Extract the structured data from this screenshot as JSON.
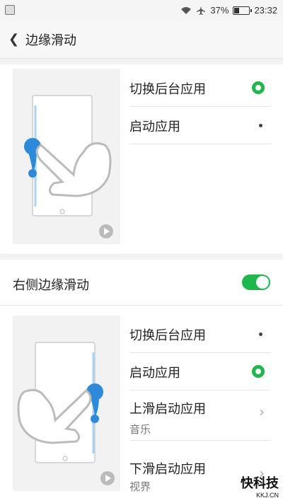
{
  "status": {
    "battery": "37%",
    "time": "23:32"
  },
  "header": {
    "title": "边缘滑动"
  },
  "left_edge": {
    "items": [
      {
        "label": "切换后台应用",
        "selected": true
      },
      {
        "label": "启动应用",
        "selected": false
      }
    ]
  },
  "right_edge": {
    "label": "右侧边缘滑动",
    "enabled": true,
    "items": [
      {
        "label": "切换后台应用",
        "selected": false
      },
      {
        "label": "启动应用",
        "selected": true
      },
      {
        "label": "上滑启动应用",
        "value": "音乐"
      },
      {
        "label": "下滑启动应用",
        "value": "视界"
      }
    ]
  },
  "watermark": {
    "main": "快科技",
    "sub": "KKJ.CN"
  },
  "colors": {
    "accent": "#1cb94a",
    "drop": "#2b8ad9"
  }
}
